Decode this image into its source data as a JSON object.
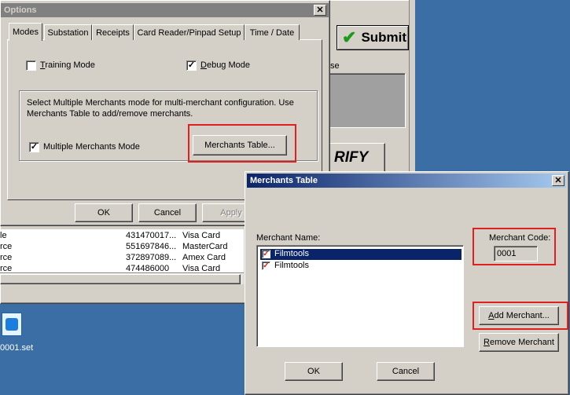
{
  "options_dialog": {
    "title": "Options",
    "tabs": [
      "Modes",
      "Substation",
      "Receipts",
      "Card Reader/Pinpad Setup",
      "Time / Date"
    ],
    "training_mode_label": "Training Mode",
    "training_mode_hotkey": "T",
    "debug_mode_label": "Debug Mode",
    "debug_mode_hotkey": "D",
    "description": "Select Multiple Merchants mode for multi-merchant configuration. Use Merchants Table to add/remove merchants.",
    "multiple_merchants_label": "Multiple Merchants Mode",
    "merchants_table_button": "Merchants Table...",
    "ok": "OK",
    "cancel": "Cancel",
    "apply": "Apply"
  },
  "background_app": {
    "submit_label": "Submit",
    "partial_label": "se",
    "verify_partial": "RIFY",
    "rows": [
      {
        "type": "le",
        "number": "431470017...",
        "card": "Visa Card"
      },
      {
        "type": "rce",
        "number": "551697846...",
        "card": "MasterCard"
      },
      {
        "type": "rce",
        "number": "372897089...",
        "card": "Amex Card"
      },
      {
        "type": "rce",
        "number": "474486000",
        "card": "Visa Card"
      }
    ]
  },
  "desktop": {
    "icon_label": "0001.set"
  },
  "merchants_dialog": {
    "title": "Merchants Table",
    "merchant_name_label": "Merchant Name:",
    "merchants": [
      {
        "name": "Filmtools",
        "checked": true,
        "selected": true
      },
      {
        "name": "Filmtools",
        "checked": true,
        "selected": false
      }
    ],
    "merchant_code_label": "Merchant Code:",
    "merchant_code_value": "0001",
    "add_merchant": "Add Merchant...",
    "remove_merchant": "Remove Merchant",
    "ok": "OK",
    "cancel": "Cancel"
  },
  "colors": {
    "desktop": "#3a6ea5",
    "window_face": "#d4d0c8",
    "selection": "#0a246a",
    "highlight_box": "#e02020"
  }
}
